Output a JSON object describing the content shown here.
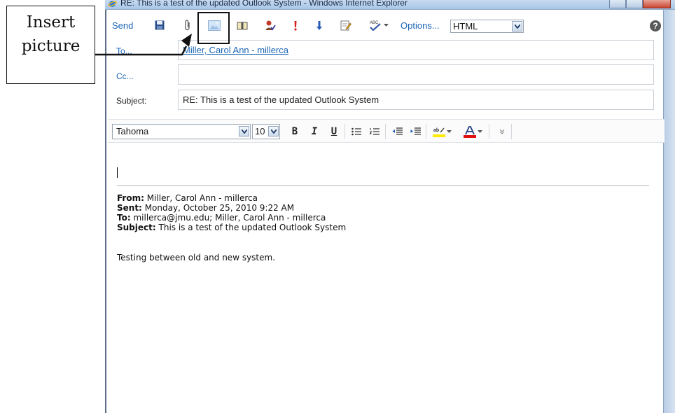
{
  "window": {
    "title": "RE: This is a test of the updated Outlook System - Windows Internet Explorer"
  },
  "toolbar": {
    "send_label": "Send",
    "options_label": "Options...",
    "format_value": "HTML"
  },
  "address": {
    "to_label": "To...",
    "to_value": "Miller, Carol Ann - millerca",
    "cc_label": "Cc...",
    "cc_value": "",
    "subject_label": "Subject:",
    "subject_value": "RE: This is a test of the updated Outlook System"
  },
  "format": {
    "font_value": "Tahoma",
    "size_value": "10",
    "bold": "B",
    "italic": "I",
    "underline": "U"
  },
  "message": {
    "from_label": "From:",
    "from_value": "Miller, Carol Ann - millerca",
    "sent_label": "Sent:",
    "sent_value": "Monday, October 25, 2010 9:22 AM",
    "to_label": "To:",
    "to_value": "millerca@jmu.edu; Miller, Carol Ann - millerca",
    "subject_label": "Subject:",
    "subject_value": "This is a test of the updated Outlook System",
    "body": "Testing between old and new system."
  },
  "annotation": {
    "line1": "Insert",
    "line2": "picture"
  },
  "colors": {
    "link": "#1a64b5",
    "chrome": "#a9c6e8"
  }
}
